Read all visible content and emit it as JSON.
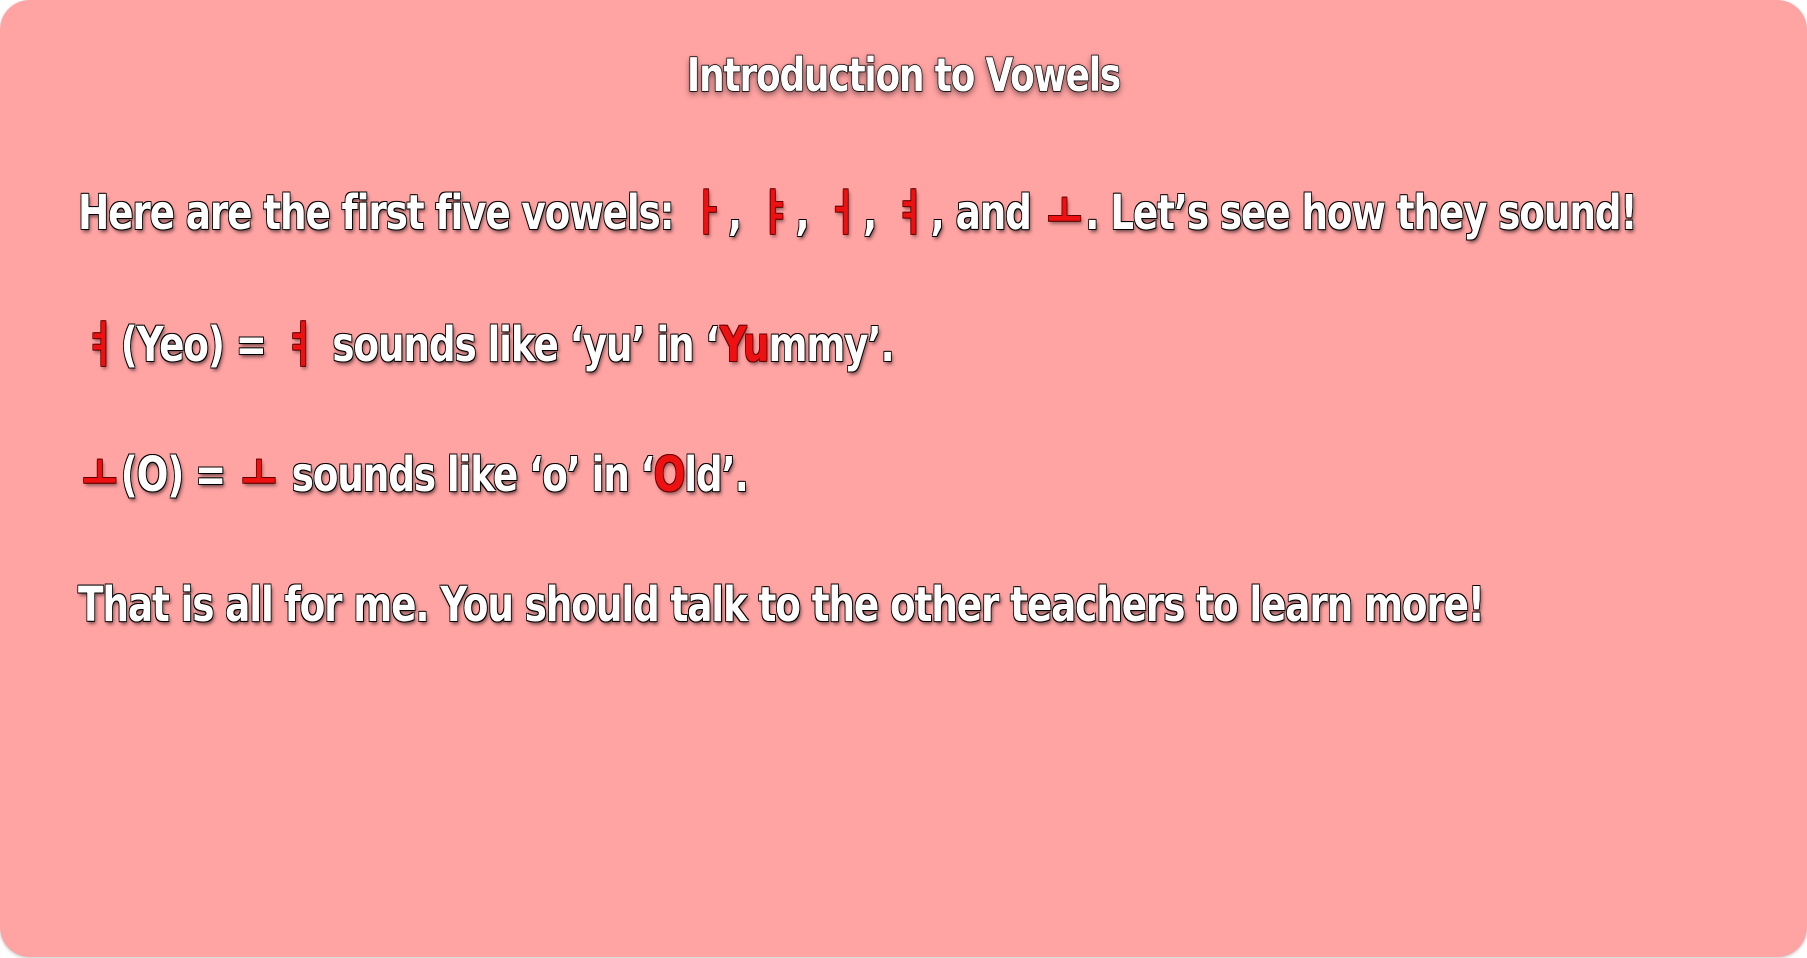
{
  "title": "Introduction to Vowels",
  "colors": {
    "background": "#ffa3a3",
    "text": "#ffffff",
    "highlight": "#ee1111"
  },
  "line1": {
    "prefix": "Here are the first five vowels:",
    "v1": "ㅏ",
    "sep1": ",",
    "v2": "ㅑ",
    "sep2": ",",
    "v3": "ㅓ",
    "sep3": ",",
    "v4": "ㅕ",
    "sep4": ", and",
    "v5": "ㅗ",
    "suffix": ". Let’s see how they sound!"
  },
  "line2": {
    "vowel": "ㅕ",
    "roman": "(Yeo) =",
    "vowel_repeat": "ㅕ",
    "text": "sounds like ‘yu’ in ‘",
    "highlight": "Yu",
    "rest": "mmy’."
  },
  "line3": {
    "vowel": "ㅗ",
    "roman": "(O) =",
    "vowel_repeat": "ㅗ",
    "text": "sounds like ‘o’ in ‘",
    "highlight": "O",
    "rest": "ld’."
  },
  "line4": {
    "text": "That is all for me. You should talk to the other teachers to learn more!"
  }
}
